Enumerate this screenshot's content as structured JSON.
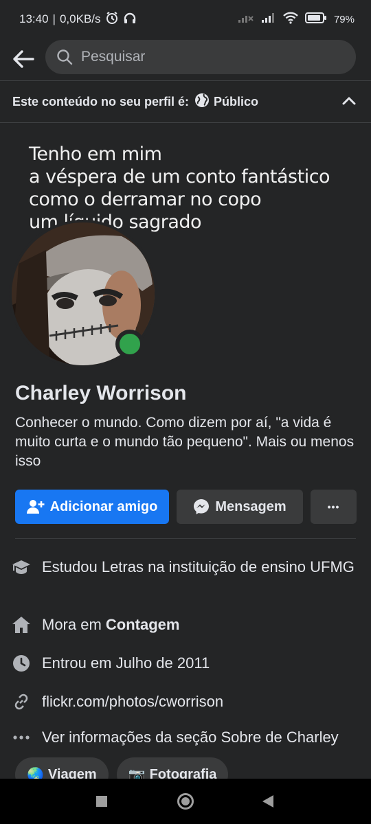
{
  "status_bar": {
    "time": "13:40",
    "net_speed": "0,0KB/s",
    "battery": "79%"
  },
  "search": {
    "placeholder": "Pesquisar"
  },
  "privacy": {
    "label": "Este conteúdo no seu perfil é:",
    "value": "Público"
  },
  "cover": {
    "lines": [
      "Tenho em mim",
      "a véspera de um conto fantástico",
      "como o derramar no copo",
      "um líquido sagrado"
    ]
  },
  "profile": {
    "name": "Charley Worrison",
    "bio": "Conhecer o mundo. Como dizem por aí, \"a vida é muito curta e o mundo tão pequeno\". Mais ou menos isso",
    "online": true
  },
  "actions": {
    "add_friend": "Adicionar amigo",
    "message": "Mensagem",
    "more": "•••"
  },
  "about": {
    "study": "Estudou Letras na instituição de ensino UFMG",
    "lives_prefix": "Mora em ",
    "lives_city": "Contagem",
    "joined": "Entrou em Julho de 2011",
    "link": "flickr.com/photos/cworrison",
    "more": "Ver informações da seção Sobre de Charley"
  },
  "interests": [
    {
      "emoji": "🌏",
      "label": "Viagem"
    },
    {
      "emoji": "📷",
      "label": "Fotografia"
    }
  ],
  "colors": {
    "background": "#242526",
    "primary": "#1877f2",
    "button": "#3a3b3c",
    "online": "#31a24c"
  }
}
